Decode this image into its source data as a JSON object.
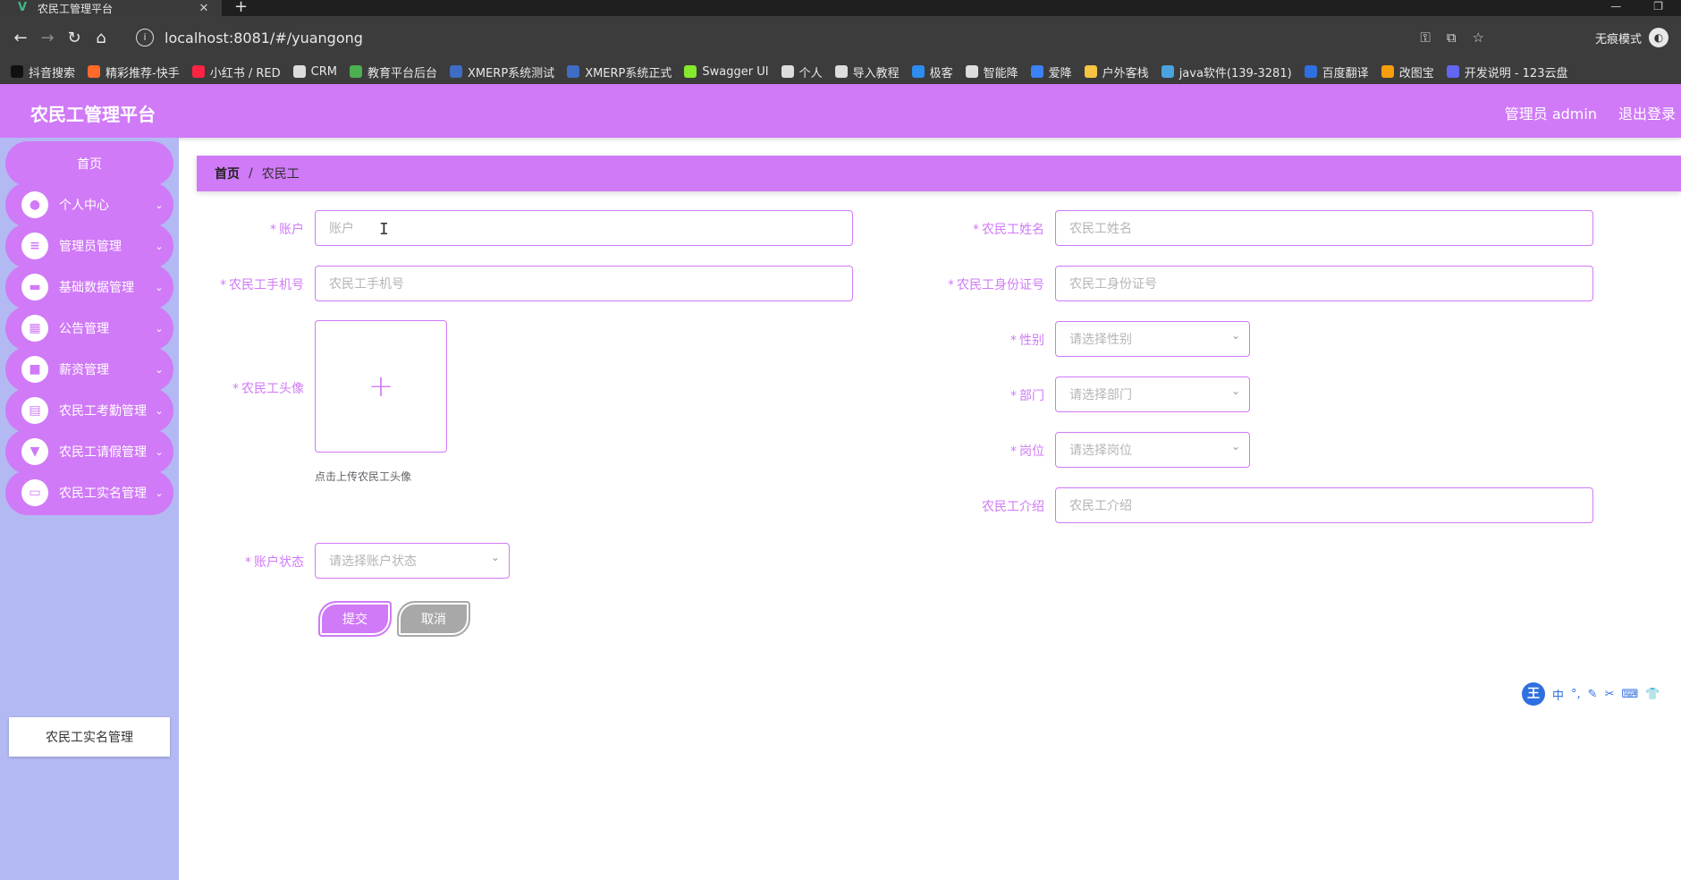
{
  "browser": {
    "tab_title": "农民工管理平台",
    "tab_close": "✕",
    "new_tab": "+",
    "url": "localhost:8081/#/yuangong",
    "incognito_label": "无痕模式",
    "bookmarks": [
      {
        "label": "抖音搜索",
        "color": "#111111"
      },
      {
        "label": "精彩推荐-快手",
        "color": "#ff6a2b"
      },
      {
        "label": "小红书 / RED",
        "color": "#ff2442"
      },
      {
        "label": "CRM",
        "color": "#dddddd"
      },
      {
        "label": "教育平台后台",
        "color": "#4caf50"
      },
      {
        "label": "XMERP系统测试",
        "color": "#3f6cc4"
      },
      {
        "label": "XMERP系统正式",
        "color": "#3f6cc4"
      },
      {
        "label": "Swagger UI",
        "color": "#85ea2d"
      },
      {
        "label": "个人",
        "color": "#dddddd"
      },
      {
        "label": "导入教程",
        "color": "#dddddd"
      },
      {
        "label": "极客",
        "color": "#2d8cf0"
      },
      {
        "label": "智能降",
        "color": "#dddddd"
      },
      {
        "label": "爱降",
        "color": "#3b82f6"
      },
      {
        "label": "户外客栈",
        "color": "#f5c542"
      },
      {
        "label": "java软件(139-3281)",
        "color": "#4aa3df"
      },
      {
        "label": "百度翻译",
        "color": "#2f6fe0"
      },
      {
        "label": "改图宝",
        "color": "#f59e0b"
      },
      {
        "label": "开发说明 - 123云盘",
        "color": "#6366f1"
      }
    ]
  },
  "header": {
    "title": "农民工管理平台",
    "admin": "管理员 admin",
    "logout": "退出登录"
  },
  "sidebar": {
    "home": "首页",
    "items": [
      {
        "label": "个人中心",
        "icon": "user-icon",
        "glyph": "●"
      },
      {
        "label": "管理员管理",
        "icon": "sliders-icon",
        "glyph": "≡"
      },
      {
        "label": "基础数据管理",
        "icon": "ticket-icon",
        "glyph": "▬"
      },
      {
        "label": "公告管理",
        "icon": "grid-icon",
        "glyph": "▦"
      },
      {
        "label": "薪资管理",
        "icon": "briefcase-icon",
        "glyph": "■"
      },
      {
        "label": "农民工考勤管理",
        "icon": "clipboard-icon",
        "glyph": "▤"
      },
      {
        "label": "农民工请假管理",
        "icon": "cup-icon",
        "glyph": "▼"
      },
      {
        "label": "农民工实名管理",
        "icon": "monitor-icon",
        "glyph": "▭"
      }
    ],
    "submenu": "农民工实名管理",
    "chevron": "⌄"
  },
  "breadcrumb": {
    "home": "首页",
    "separator": "/",
    "current": "农民工"
  },
  "form": {
    "account": {
      "label": "账户",
      "placeholder": "账户"
    },
    "name": {
      "label": "农民工姓名",
      "placeholder": "农民工姓名"
    },
    "phone": {
      "label": "农民工手机号",
      "placeholder": "农民工手机号"
    },
    "idcard": {
      "label": "农民工身份证号",
      "placeholder": "农民工身份证号"
    },
    "avatar": {
      "label": "农民工头像",
      "tip": "点击上传农民工头像",
      "plus": "+"
    },
    "gender": {
      "label": "性别",
      "placeholder": "请选择性别"
    },
    "department": {
      "label": "部门",
      "placeholder": "请选择部门"
    },
    "position": {
      "label": "岗位",
      "placeholder": "请选择岗位"
    },
    "intro": {
      "label": "农民工介绍",
      "placeholder": "农民工介绍"
    },
    "status": {
      "label": "账户状态",
      "placeholder": "请选择账户状态"
    },
    "required_mark": "*",
    "submit": "提交",
    "cancel": "取消",
    "select_arrow": "⌄"
  },
  "ime": {
    "logo": "王",
    "items": [
      "中",
      "°,",
      "✎",
      "✂",
      "⌨",
      "👕"
    ]
  },
  "colors": {
    "primary": "#d07af7",
    "sidebar_bg": "#b3b9f3",
    "cancel": "#a8a8a8"
  }
}
